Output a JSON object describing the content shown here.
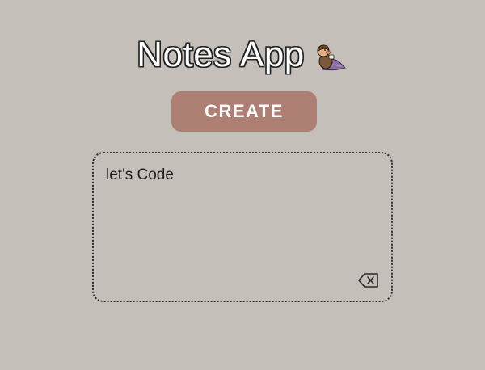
{
  "header": {
    "title": "Notes App",
    "mascot_icon": "mascot-illustration-icon"
  },
  "toolbar": {
    "create_label": "CREATE"
  },
  "notes": [
    {
      "text": "let's Code",
      "delete_icon": "backspace-icon"
    }
  ],
  "colors": {
    "background": "#c4bfb9",
    "create_button": "#ae7f73",
    "title_fill": "#ffffff",
    "title_outline": "#222222",
    "card_border": "#2a2a2a"
  }
}
